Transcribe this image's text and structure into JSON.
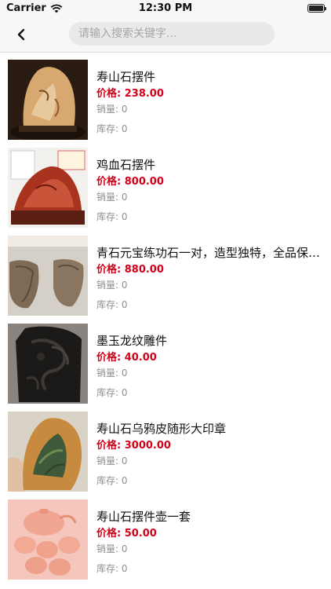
{
  "status_bar": {
    "carrier": "Carrier",
    "time": "12:30 PM"
  },
  "nav": {
    "back_icon": "chevron-left-icon",
    "search_placeholder": "请输入搜索关键字..."
  },
  "products": [
    {
      "name": "寿山石摆件",
      "price": "价格: 238.00",
      "sales": "销量: 0",
      "stock": "库存: 0"
    },
    {
      "name": "鸡血石摆件",
      "price": "价格: 800.00",
      "sales": "销量: 0",
      "stock": "库存: 0"
    },
    {
      "name": "青石元宝练功石一对，造型独特，全品保存完好",
      "price": "价格: 880.00",
      "sales": "销量: 0",
      "stock": "库存: 0"
    },
    {
      "name": "墨玉龙纹雕件",
      "price": "价格: 40.00",
      "sales": "销量: 0",
      "stock": "库存: 0"
    },
    {
      "name": "寿山石乌鸦皮随形大印章",
      "price": "价格: 3000.00",
      "sales": "销量: 0",
      "stock": "库存: 0"
    },
    {
      "name": "寿山石摆件壶一套",
      "price": "价格: 50.00",
      "sales": "销量: 0",
      "stock": "库存: 0"
    }
  ],
  "colors": {
    "price": "#d0021b",
    "muted": "#8e8e8e",
    "search_bg": "#e9e9e9"
  }
}
